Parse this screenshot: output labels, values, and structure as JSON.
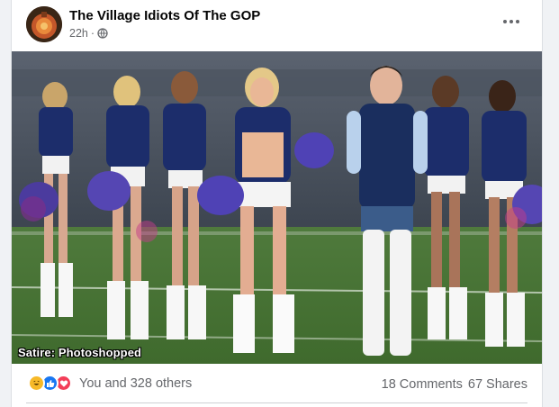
{
  "post": {
    "group_name": "The Village Idiots Of The GOP",
    "time": "22h",
    "privacy_icon": "globe-icon",
    "more_icon": "more-options-icon"
  },
  "image": {
    "caption": "Satire: Photoshopped",
    "description_icon": "photo"
  },
  "footer": {
    "reaction_icons": [
      "haha-icon",
      "like-icon",
      "love-icon"
    ],
    "reactions_text": "You and 328 others",
    "comments": "18 Comments",
    "shares": "67 Shares"
  },
  "colors": {
    "like_blue": "#1877f2",
    "love_red": "#f33e58",
    "haha_yellow": "#f7b928",
    "meta_gray": "#65676b"
  }
}
